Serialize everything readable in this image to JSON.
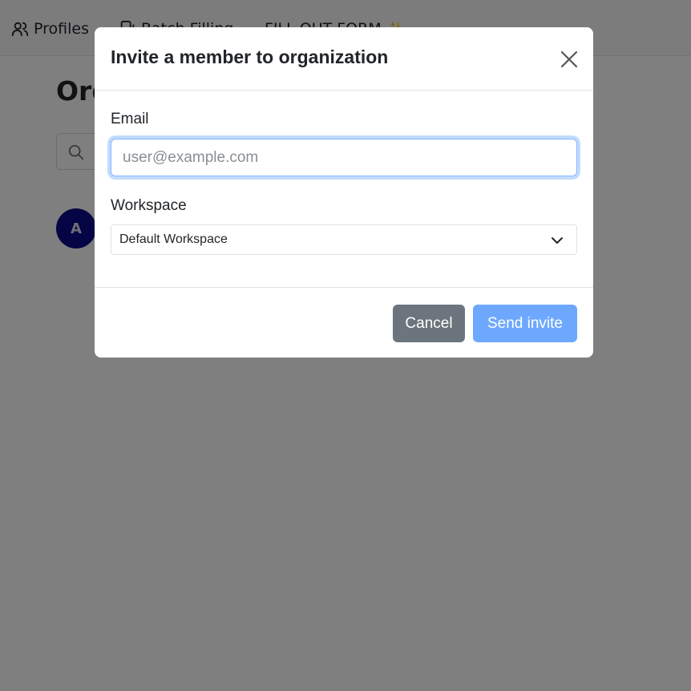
{
  "nav": {
    "profiles_label": "Profiles",
    "batch_label": "Batch Filling",
    "fill_label": "FILL OUT FORM",
    "fill_icon": "sparkle-icon"
  },
  "page": {
    "title": "Organization",
    "avatar_initial": "A"
  },
  "modal": {
    "title": "Invite a member to organization",
    "email_label": "Email",
    "email_placeholder": "user@example.com",
    "email_value": "",
    "workspace_label": "Workspace",
    "workspace_selected": "Default Workspace",
    "cancel_label": "Cancel",
    "send_label": "Send invite"
  },
  "colors": {
    "backdrop": "#808080",
    "cancel": "#6c757d",
    "send": "#6ea8fe",
    "avatar": "#0a0a8a"
  }
}
